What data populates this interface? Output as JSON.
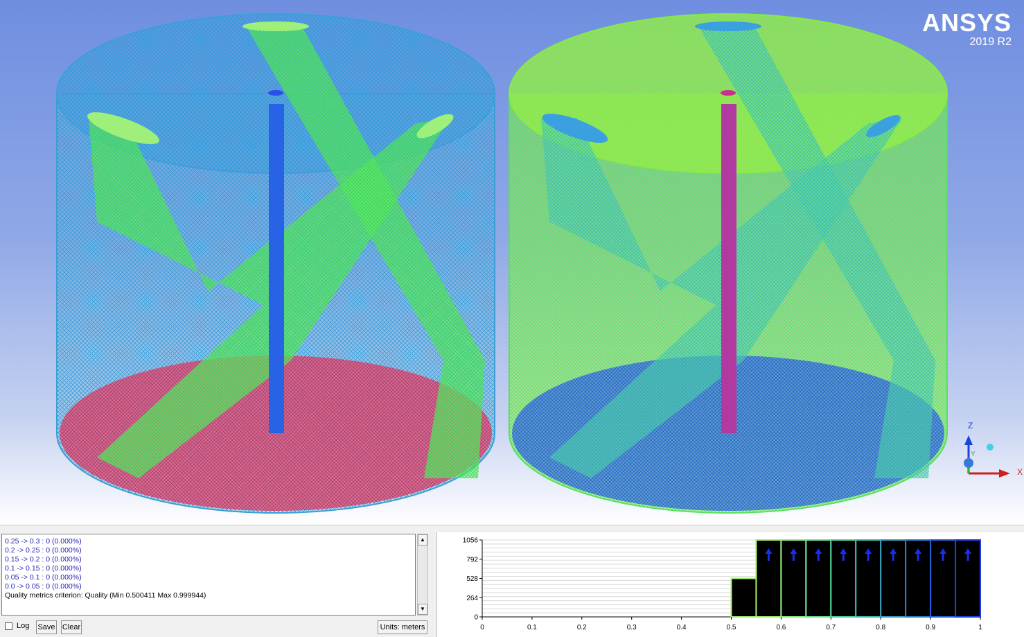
{
  "brand": {
    "name": "ANSYS",
    "version": "2019 R2"
  },
  "axes_triad": {
    "z": "Z",
    "y": "Y",
    "x": "X"
  },
  "console": {
    "lines": [
      "0.25 -> 0.3 : 0 (0.000%)",
      "0.2 -> 0.25 : 0 (0.000%)",
      "0.15 -> 0.2 : 0 (0.000%)",
      "0.1 -> 0.15 : 0 (0.000%)",
      "0.05 -> 0.1 : 0 (0.000%)",
      "0.0 -> 0.05 : 0 (0.000%)"
    ],
    "criterion": "Quality metrics criterion: Quality (Min 0.500411 Max 0.999944)"
  },
  "controls": {
    "log_label": "Log",
    "save_label": "Save",
    "clear_label": "Clear",
    "units_label": "Units: meters",
    "log_checked": false
  },
  "chart_data": {
    "type": "bar",
    "x_ticks": [
      "0",
      "0.1",
      "0.2",
      "0.3",
      "0.4",
      "0.5",
      "0.6",
      "0.7",
      "0.8",
      "0.9",
      "1"
    ],
    "y_ticks": [
      "0",
      "264",
      "528",
      "792",
      "1056"
    ],
    "xlim": [
      0,
      1
    ],
    "ylim": [
      0,
      1056
    ],
    "bins": [
      {
        "from": 0.5,
        "to": 0.55,
        "value": 528,
        "clipped": false
      },
      {
        "from": 0.55,
        "to": 0.6,
        "value": 1056,
        "clipped": true
      },
      {
        "from": 0.6,
        "to": 0.65,
        "value": 1056,
        "clipped": true
      },
      {
        "from": 0.65,
        "to": 0.7,
        "value": 1056,
        "clipped": true
      },
      {
        "from": 0.7,
        "to": 0.75,
        "value": 1056,
        "clipped": true
      },
      {
        "from": 0.75,
        "to": 0.8,
        "value": 1056,
        "clipped": true
      },
      {
        "from": 0.8,
        "to": 0.85,
        "value": 1056,
        "clipped": true
      },
      {
        "from": 0.85,
        "to": 0.9,
        "value": 1056,
        "clipped": true
      },
      {
        "from": 0.9,
        "to": 0.95,
        "value": 1056,
        "clipped": true
      },
      {
        "from": 0.95,
        "to": 1.0,
        "value": 1056,
        "clipped": true
      }
    ],
    "bar_fill": "#000000",
    "bar_outline_colors": [
      "#a8f070",
      "#a8f070",
      "#90f080",
      "#70e890",
      "#50d8a0",
      "#40c0b0",
      "#3aa0c0",
      "#3080d0",
      "#2a60e0",
      "#2040f0"
    ],
    "grid": true
  },
  "colors": {
    "mesh_blue": "#3fa4d8",
    "mesh_green": "#59f04a",
    "mesh_red": "#d0466e",
    "shaft_blue": "#2863e6",
    "shaft_magenta": "#b03aa0"
  }
}
